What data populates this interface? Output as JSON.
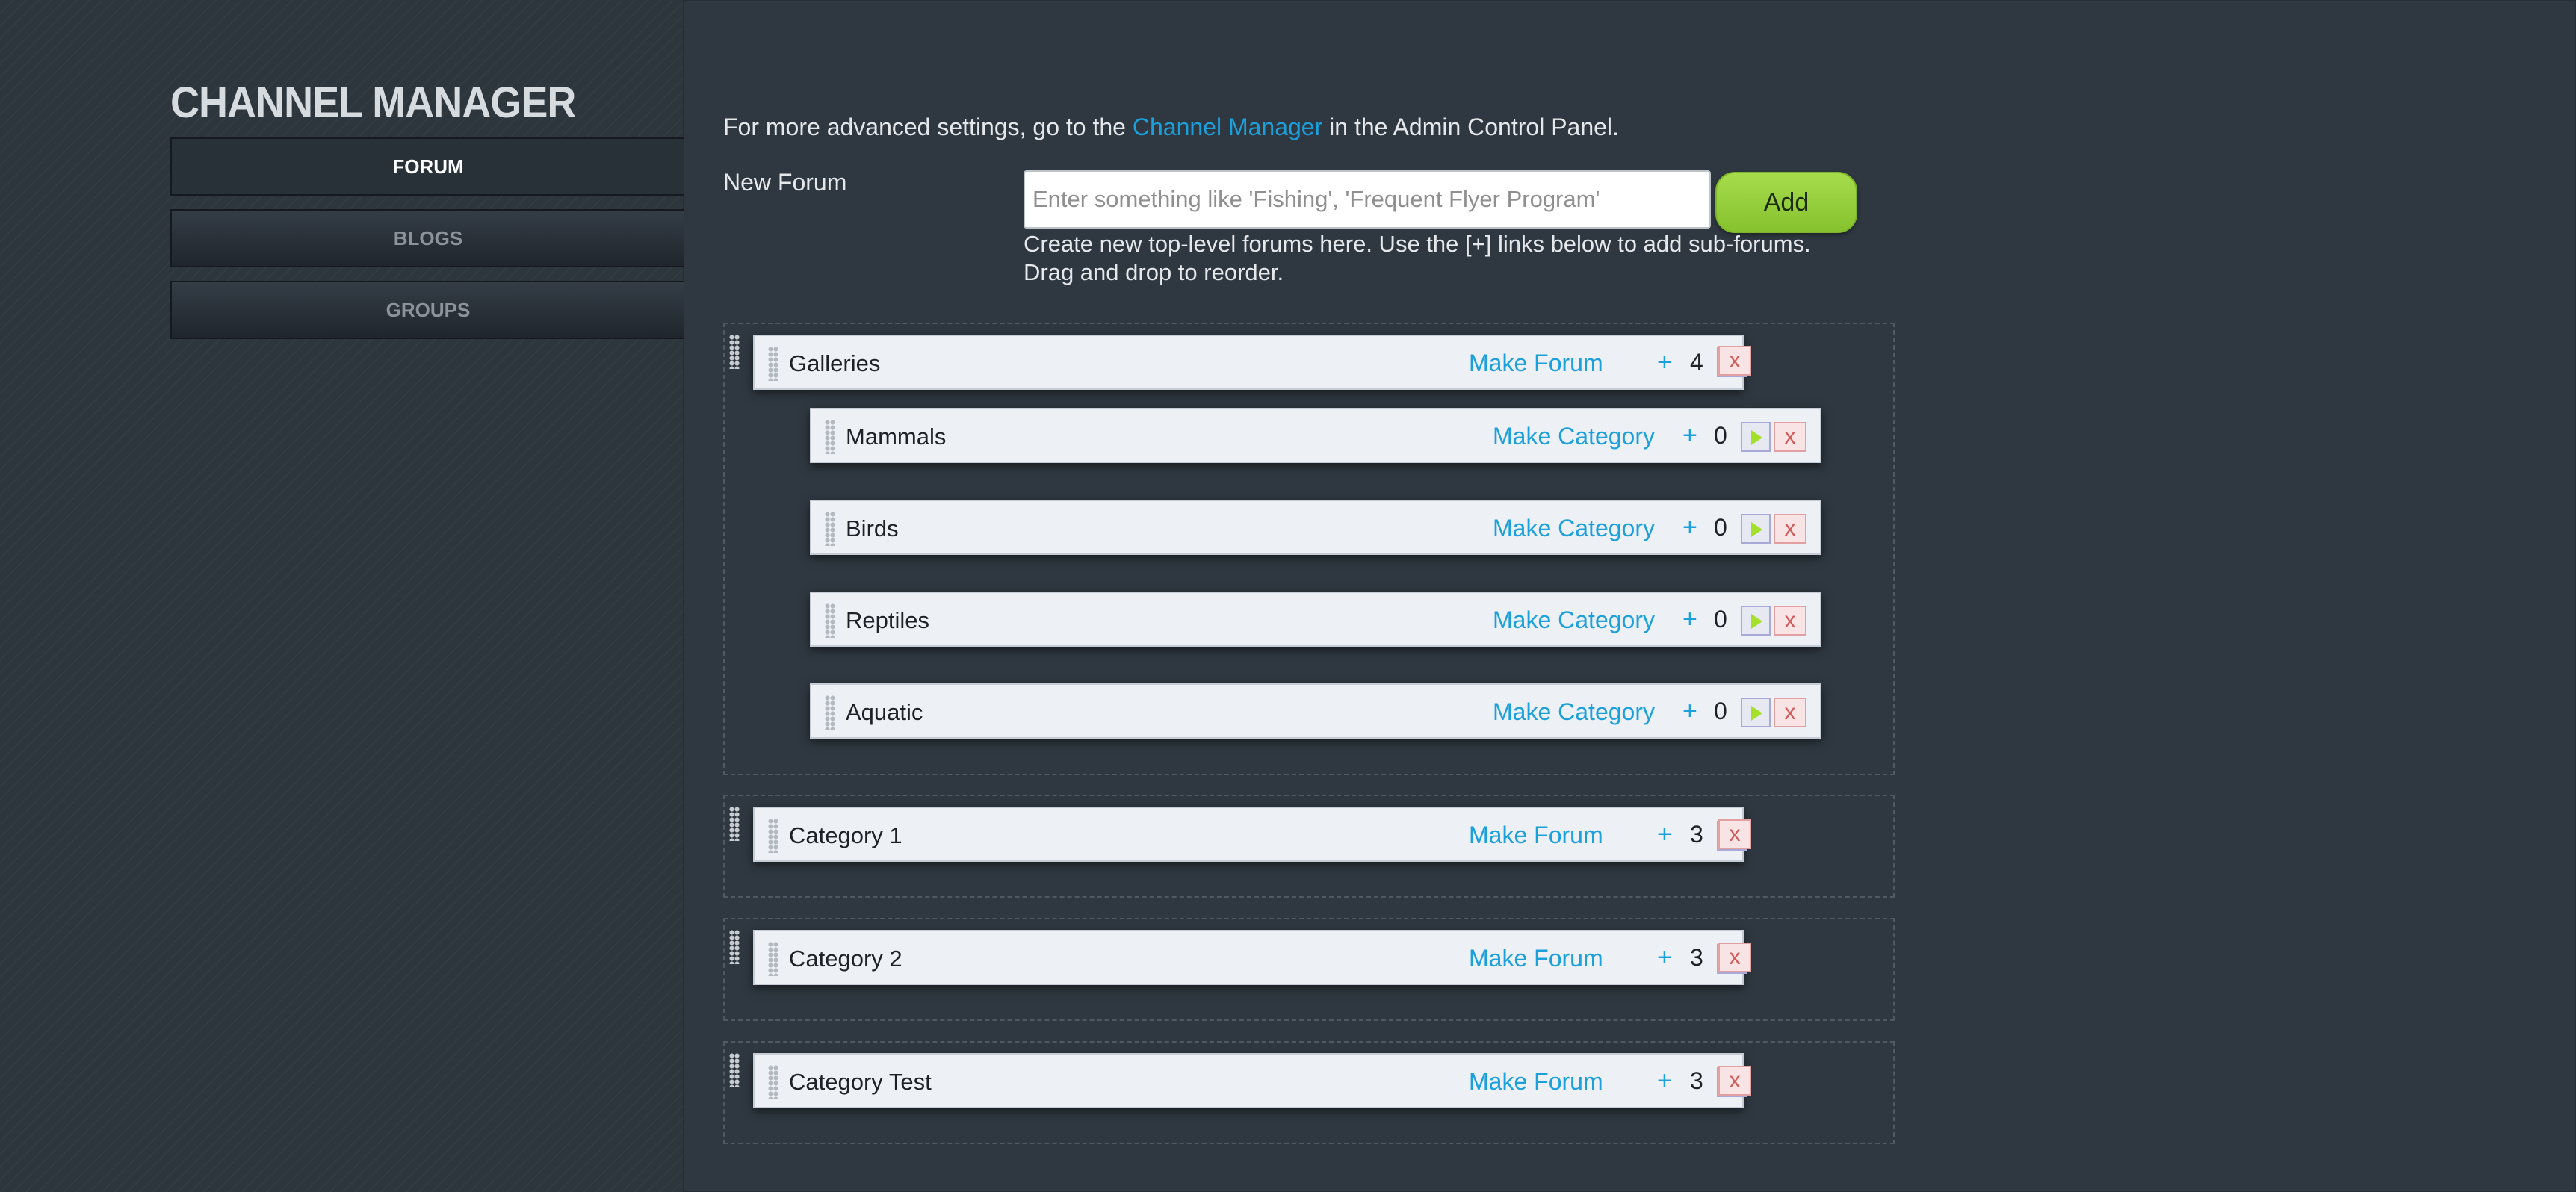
{
  "app": {
    "title": "CHANNEL MANAGER"
  },
  "nav": {
    "items": [
      {
        "label": "FORUM",
        "active": true
      },
      {
        "label": "BLOGS",
        "active": false
      },
      {
        "label": "GROUPS",
        "active": false
      }
    ]
  },
  "intro": {
    "prefix": "For more advanced settings, go to the ",
    "link": "Channel Manager",
    "suffix": " in the Admin Control Panel."
  },
  "new_forum": {
    "label": "New Forum",
    "placeholder": "Enter something like 'Fishing', 'Frequent Flyer Program'",
    "value": "",
    "add_label": "Add",
    "help_line1": "Create new top-level forums here. Use the [+] links below to add sub-forums.",
    "help_line2": "Drag and drop to reorder."
  },
  "groups": [
    {
      "name": "Galleries",
      "action": "Make Forum",
      "plus": "+",
      "count": "4",
      "expanded": true,
      "delete": "x",
      "children": [
        {
          "name": "Mammals",
          "action": "Make Category",
          "plus": "+",
          "count": "0",
          "delete": "x"
        },
        {
          "name": "Birds",
          "action": "Make Category",
          "plus": "+",
          "count": "0",
          "delete": "x"
        },
        {
          "name": "Reptiles",
          "action": "Make Category",
          "plus": "+",
          "count": "0",
          "delete": "x"
        },
        {
          "name": "Aquatic",
          "action": "Make Category",
          "plus": "+",
          "count": "0",
          "delete": "x"
        }
      ]
    },
    {
      "name": "Category 1",
      "action": "Make Forum",
      "plus": "+",
      "count": "3",
      "expanded": false,
      "delete": "x",
      "children": []
    },
    {
      "name": "Category 2",
      "action": "Make Forum",
      "plus": "+",
      "count": "3",
      "expanded": false,
      "delete": "x",
      "children": []
    },
    {
      "name": "Category Test",
      "action": "Make Forum",
      "plus": "+",
      "count": "3",
      "expanded": false,
      "delete": "x",
      "children": []
    }
  ],
  "colors": {
    "background": "#2f3841",
    "link": "#1ba0dc",
    "add_button": "#94cd3a",
    "toggle_arrow": "#a4e02a",
    "delete": "#d35a5a"
  },
  "icons": {
    "drag_handle": "drag-handle-icon",
    "expand": "expand-arrow-icon",
    "delete": "delete-icon"
  }
}
